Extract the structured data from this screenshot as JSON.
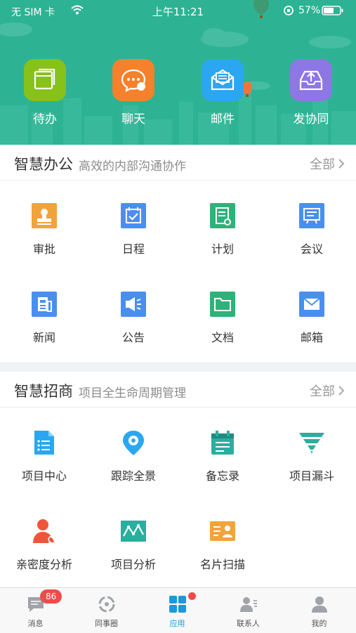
{
  "status_bar": {
    "carrier": "无 SIM 卡",
    "time": "上午11:21",
    "battery": "57%"
  },
  "top_apps": [
    {
      "label": "待办",
      "color": "#86c219",
      "icon": "stack-icon"
    },
    {
      "label": "聊天",
      "color": "#f5812c",
      "icon": "chat-icon"
    },
    {
      "label": "邮件",
      "color": "#2aa7f0",
      "icon": "mail-icon"
    },
    {
      "label": "发协同",
      "color": "#8d77e4",
      "icon": "upload-tray-icon"
    }
  ],
  "office": {
    "title": "智慧办公",
    "subtitle": "高效的内部沟通协作",
    "all_label": "全部",
    "items": [
      {
        "label": "审批",
        "icon": "stamp-icon",
        "color": "#f2a33a"
      },
      {
        "label": "日程",
        "icon": "calendar-check-icon",
        "color": "#4a8ff0"
      },
      {
        "label": "计划",
        "icon": "plan-document-icon",
        "color": "#2db37a"
      },
      {
        "label": "会议",
        "icon": "meeting-board-icon",
        "color": "#4a8ff0"
      },
      {
        "label": "新闻",
        "icon": "news-icon",
        "color": "#4a8ff0"
      },
      {
        "label": "公告",
        "icon": "megaphone-icon",
        "color": "#4a8ff0"
      },
      {
        "label": "文档",
        "icon": "folder-icon",
        "color": "#2db37a"
      },
      {
        "label": "邮箱",
        "icon": "mailbox-icon",
        "color": "#4a8ff0"
      }
    ]
  },
  "investment": {
    "title": "智慧招商",
    "subtitle": "项目全生命周期管理",
    "all_label": "全部",
    "items": [
      {
        "label": "项目中心",
        "icon": "project-list-icon",
        "color": "#2aa7f0"
      },
      {
        "label": "跟踪全景",
        "icon": "location-pin-icon",
        "color": "#2aa7f0"
      },
      {
        "label": "备忘录",
        "icon": "memo-icon",
        "color": "#2aaea0"
      },
      {
        "label": "项目漏斗",
        "icon": "funnel-icon",
        "color": "#2aaea0"
      },
      {
        "label": "亲密度分析",
        "icon": "contact-phone-icon",
        "color": "#f0553a"
      },
      {
        "label": "项目分析",
        "icon": "line-chart-icon",
        "color": "#2aaea0"
      },
      {
        "label": "名片扫描",
        "icon": "business-card-icon",
        "color": "#f2a33a"
      }
    ]
  },
  "tabbar": {
    "tabs": [
      {
        "label": "消息",
        "icon": "message-icon",
        "badge": "86"
      },
      {
        "label": "同事圈",
        "icon": "colleague-circle-icon"
      },
      {
        "label": "应用",
        "icon": "apps-grid-icon",
        "active": true
      },
      {
        "label": "联系人",
        "icon": "contacts-icon"
      },
      {
        "label": "我的",
        "icon": "profile-icon"
      }
    ]
  }
}
